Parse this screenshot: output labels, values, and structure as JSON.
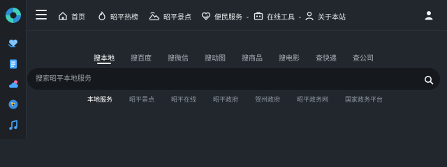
{
  "icons": {
    "logo": "logo-icon",
    "sidebar": [
      "heart-hands-icon",
      "document-icon",
      "cloud-icon",
      "compass-icon",
      "music-icon"
    ],
    "menu": "hamburger-menu-icon",
    "user": "user-icon",
    "search": "search-icon"
  },
  "colors": {
    "background": "#22272d",
    "sidebar": "#1d2126",
    "search_box": "#15191d",
    "accent_teal": "#3fd0b8",
    "accent_blue": "#2a8fd6"
  },
  "nav": {
    "items": [
      {
        "label": "首页",
        "icon": "home-icon"
      },
      {
        "label": "昭平热榜",
        "icon": "flame-icon"
      },
      {
        "label": "昭平景点",
        "icon": "landscape-icon"
      },
      {
        "label": "便民服务",
        "icon": "heart-service-icon",
        "dropdown": true
      },
      {
        "label": "在线工具",
        "icon": "toolbox-icon",
        "dropdown": true
      },
      {
        "label": "关于本站",
        "icon": "person-icon"
      }
    ]
  },
  "search": {
    "tabs": [
      "搜本地",
      "搜百度",
      "搜微信",
      "搜动图",
      "搜商品",
      "搜电影",
      "查快递",
      "查公司"
    ],
    "active_tab": "搜本地",
    "placeholder": "搜索昭平本地服务",
    "value": ""
  },
  "quick_links": {
    "items": [
      "本地服务",
      "昭平景点",
      "昭平在线",
      "昭平政府",
      "贺州政府",
      "昭平政务网",
      "国家政务平台"
    ],
    "active": "本地服务"
  }
}
